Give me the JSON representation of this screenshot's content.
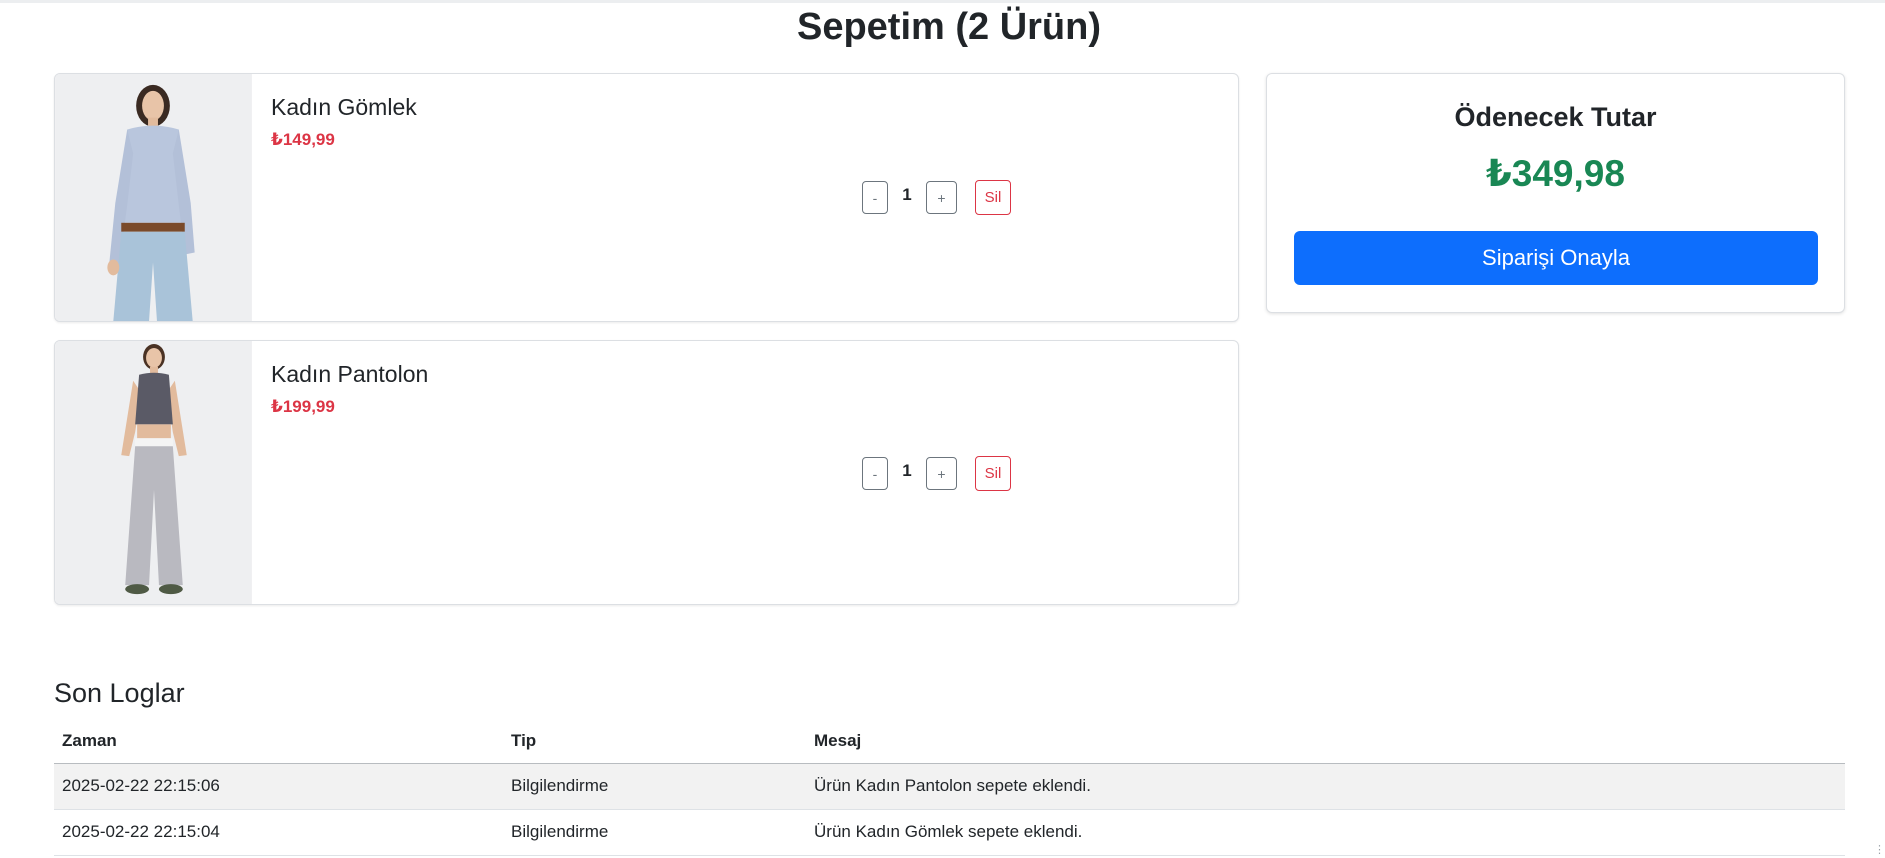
{
  "page": {
    "title": "Sepetim (2 Ürün)"
  },
  "cart": {
    "items": [
      {
        "name": "Kadın Gömlek",
        "price": "₺149,99",
        "quantity": "1",
        "decrement_label": "-",
        "increment_label": "+",
        "delete_label": "Sil"
      },
      {
        "name": "Kadın Pantolon",
        "price": "₺199,99",
        "quantity": "1",
        "decrement_label": "-",
        "increment_label": "+",
        "delete_label": "Sil"
      }
    ]
  },
  "summary": {
    "title": "Ödenecek Tutar",
    "total": "₺349,98",
    "confirm_label": "Siparişi Onayla"
  },
  "logs": {
    "title": "Son Loglar",
    "columns": [
      "Zaman",
      "Tip",
      "Mesaj"
    ],
    "rows": [
      [
        "2025-02-22 22:15:06",
        "Bilgilendirme",
        "Ürün Kadın Pantolon sepete eklendi."
      ],
      [
        "2025-02-22 22:15:04",
        "Bilgilendirme",
        "Ürün Kadın Gömlek sepete eklendi."
      ]
    ]
  },
  "colors": {
    "primary": "#0d6efd",
    "danger": "#dc3545",
    "success": "#198754",
    "secondary": "#6c757d"
  }
}
